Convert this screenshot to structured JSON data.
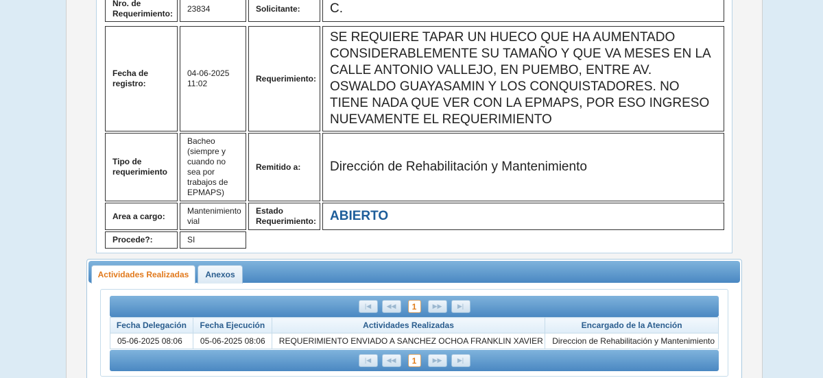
{
  "record": {
    "nro_label": "Nro. de Requerimiento:",
    "nro_value": "23834",
    "solicitante_label": "Solicitante:",
    "solicitante_value": "C.",
    "fecha_label": "Fecha de registro:",
    "fecha_value": "04-06-2025 11:02",
    "requerimiento_label": "Requerimiento:",
    "requerimiento_value": "SE REQUIERE TAPAR UN HUECO QUE HA AUMENTADO CONSIDERABLEMENTE SU TAMAÑO Y QUE VA MESES EN LA CALLE ANTONIO VALLEJO, EN PUEMBO, ENTRE AV. OSWALDO GUAYASAMIN Y LOS CONQUISTADORES. NO TIENE NADA QUE VER CON LA EPMAPS, POR ESO INGRESO NUEVAMENTE EL REQUERIMIENTO",
    "tipo_label": "Tipo de requerimiento",
    "tipo_value": "Bacheo (siempre y cuando no sea por trabajos de EPMAPS)",
    "remitido_label": "Remitido a:",
    "remitido_value": "Dirección de Rehabilitación y Mantenimiento",
    "area_label": "Area a cargo:",
    "area_value": "Mantenimiento vial",
    "estado_label": "Estado Requerimiento:",
    "estado_value": "ABIERTO",
    "procede_label": "Procede?:",
    "procede_value": "SI"
  },
  "tabs": [
    {
      "label": "Actividades Realizadas",
      "active": true
    },
    {
      "label": "Anexos",
      "active": false
    }
  ],
  "pager": {
    "current_page": "1",
    "first_icon": "first-page-icon",
    "prev_icon": "prev-page-icon",
    "next_icon": "next-page-icon",
    "last_icon": "last-page-icon"
  },
  "activities": {
    "headers": [
      "Fecha Delegación",
      "Fecha Ejecución",
      "Actividades Realizadas",
      "Encargado de la Atención"
    ],
    "rows": [
      [
        "05-06-2025 08:06",
        "05-06-2025 08:06",
        "REQUERIMIENTO ENVIADO A SANCHEZ OCHOA FRANKLIN XAVIER",
        "Direccion de Rehabilitación y Mantenimiento"
      ]
    ]
  },
  "colors": {
    "status_blue": "#1d5d9a",
    "tab_active_orange": "#e1791c",
    "header_blue": "#2a5d8e"
  }
}
